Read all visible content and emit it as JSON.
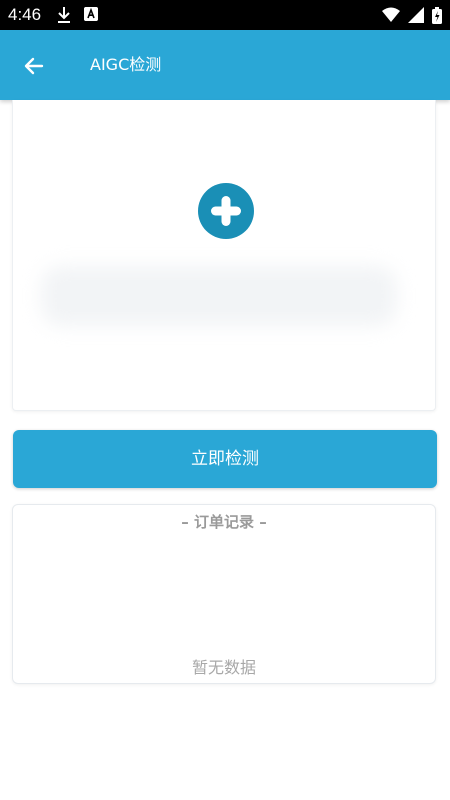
{
  "status_bar": {
    "time": "4:46",
    "icons": [
      "download-icon",
      "app-notification-icon",
      "wifi-icon",
      "signal-icon",
      "battery-charging-icon"
    ]
  },
  "app_bar": {
    "title": "AIGC检测",
    "back_icon": "arrow-back-icon",
    "background": "#2aa7d6"
  },
  "upload": {
    "icon": "add-circle-icon",
    "icon_color": "#1a8fb6"
  },
  "detect_button": {
    "label": "立即检测",
    "background": "#2aa7d6"
  },
  "orders": {
    "heading": "– 订单记录 –",
    "empty_text": "暂无数据"
  }
}
